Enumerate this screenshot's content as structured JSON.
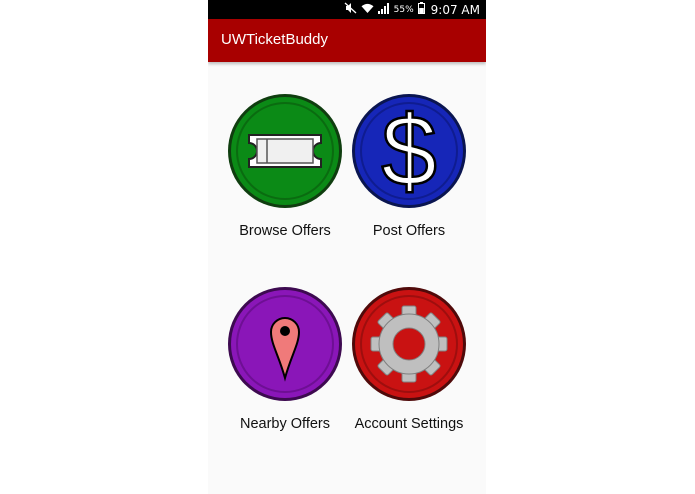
{
  "status_bar": {
    "battery_percent": "55%",
    "time": "9:07 AM"
  },
  "app_bar": {
    "title": "UWTicketBuddy"
  },
  "tiles": [
    {
      "label": "Browse Offers",
      "icon": "ticket-icon",
      "color": "#0b8a16"
    },
    {
      "label": "Post Offers",
      "icon": "dollar-icon",
      "color": "#1626b8"
    },
    {
      "label": "Nearby Offers",
      "icon": "map-pin-icon",
      "color": "#8a16b8"
    },
    {
      "label": "Account Settings",
      "icon": "gear-icon",
      "color": "#c91212"
    }
  ]
}
